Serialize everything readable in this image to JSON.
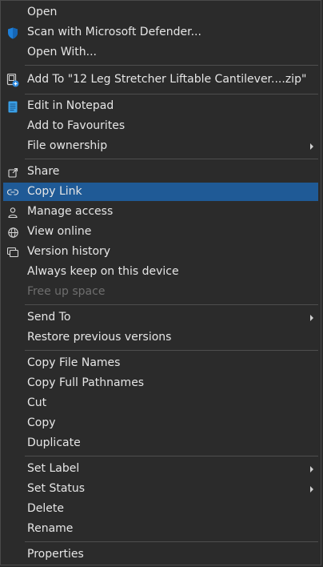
{
  "menu": {
    "items": [
      {
        "label": "Open",
        "icon": null
      },
      {
        "label": "Scan with Microsoft Defender...",
        "icon": "defender-shield-icon"
      },
      {
        "label": "Open With...",
        "icon": null
      },
      {
        "label": "Add To \"12 Leg Stretcher Liftable Cantilever....zip\"",
        "icon": "archive-add-icon"
      },
      {
        "label": "Edit in Notepad",
        "icon": "notepad-icon"
      },
      {
        "label": "Add to Favourites",
        "icon": null
      },
      {
        "label": "File ownership",
        "icon": null,
        "submenu": true
      },
      {
        "label": "Share",
        "icon": "share-icon"
      },
      {
        "label": "Copy Link",
        "icon": "link-icon",
        "highlighted": true
      },
      {
        "label": "Manage access",
        "icon": "person-icon"
      },
      {
        "label": "View online",
        "icon": "globe-icon"
      },
      {
        "label": "Version history",
        "icon": "version-history-icon"
      },
      {
        "label": "Always keep on this device",
        "icon": null
      },
      {
        "label": "Free up space",
        "icon": null,
        "disabled": true
      },
      {
        "label": "Send To",
        "icon": null,
        "submenu": true
      },
      {
        "label": "Restore previous versions",
        "icon": null
      },
      {
        "label": "Copy File Names",
        "icon": null
      },
      {
        "label": "Copy Full Pathnames",
        "icon": null
      },
      {
        "label": "Cut",
        "icon": null
      },
      {
        "label": "Copy",
        "icon": null
      },
      {
        "label": "Duplicate",
        "icon": null
      },
      {
        "label": "Set Label",
        "icon": null,
        "submenu": true
      },
      {
        "label": "Set Status",
        "icon": null,
        "submenu": true
      },
      {
        "label": "Delete",
        "icon": null
      },
      {
        "label": "Rename",
        "icon": null
      },
      {
        "label": "Properties",
        "icon": null
      }
    ]
  },
  "colors": {
    "background": "#2b2b2b",
    "highlight": "#1f5a96",
    "text": "#e6e6e6",
    "disabled_text": "#6e6e6e",
    "separator": "#4e4e4e",
    "defender_blue": "#1e7fd8",
    "notepad_blue": "#3aa0e8"
  }
}
